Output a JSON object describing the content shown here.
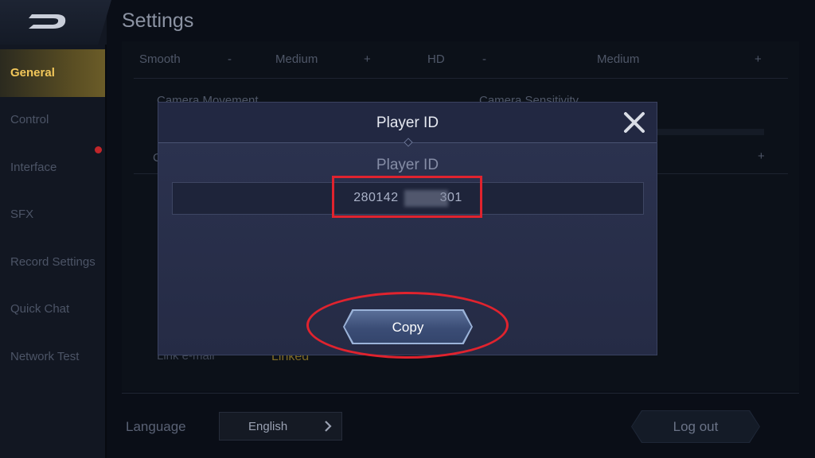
{
  "header": {
    "title": "Settings"
  },
  "sidebar": {
    "items": [
      {
        "label": "General",
        "active": true
      },
      {
        "label": "Control"
      },
      {
        "label": "Interface",
        "has_notification": true
      },
      {
        "label": "SFX"
      },
      {
        "label": "Record Settings"
      },
      {
        "label": "Quick Chat"
      },
      {
        "label": "Network Test"
      }
    ]
  },
  "settings": {
    "row1": {
      "left_value": "Smooth",
      "left_minus": "-",
      "left_mid": "Medium",
      "left_plus": "+",
      "right_value": "HD",
      "right_minus": "-",
      "right_mid": "Medium",
      "right_plus": "+"
    },
    "camera_movement": "Camera Movement",
    "camera_sensitivity": "Camera Sensitivity",
    "row3_plus": "+",
    "partial_c": "C",
    "link_email": "Link e-mail",
    "link_status": "Linked"
  },
  "footer": {
    "language_label": "Language",
    "language_value": "English",
    "logout_label": "Log out"
  },
  "modal": {
    "title": "Player ID",
    "subtitle": "Player ID",
    "player_id_prefix": "280142",
    "player_id_suffix": "301",
    "copy_label": "Copy"
  },
  "colors": {
    "accent_gold": "#f2c75a",
    "annotation_red": "#e0232e",
    "modal_bg": "#2c3350"
  }
}
